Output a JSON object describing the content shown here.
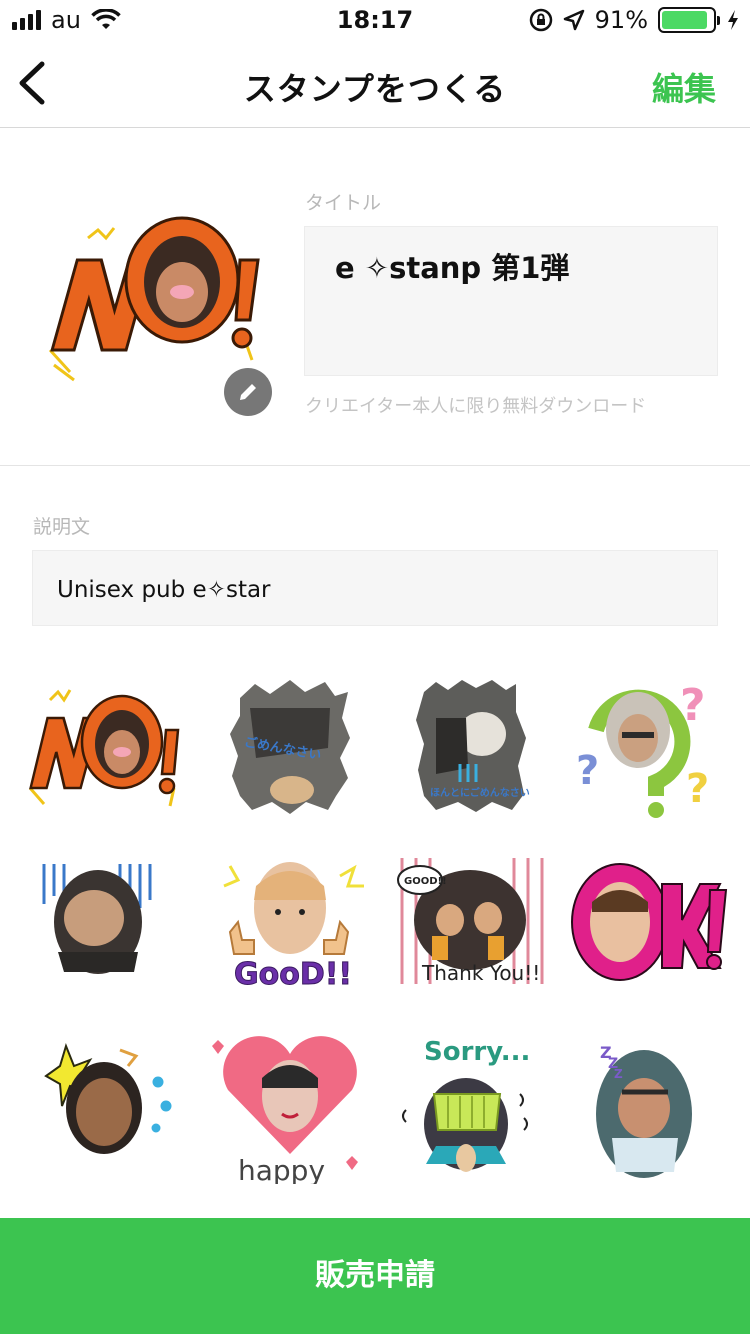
{
  "status_bar": {
    "carrier": "au",
    "time": "18:17",
    "battery": "91%",
    "battery_level": 0.91
  },
  "nav": {
    "back_icon": "chevron-left-icon",
    "title": "スタンプをつくる",
    "edit_label": "編集"
  },
  "sticker_main": {
    "text": "NO!",
    "edit_icon": "pencil-icon"
  },
  "form": {
    "title_label": "タイトル",
    "title_value": "e ✧stanp 第1弾",
    "title_hint": "クリエイター本人に限り無料ダウンロード",
    "description_label": "説明文",
    "description_value": "Unisex pub  e✧star"
  },
  "stickers": [
    {
      "name": "sticker-no",
      "text": "NO!"
    },
    {
      "name": "sticker-gomennasai",
      "text": "ごめんなさい"
    },
    {
      "name": "sticker-hontoni-gomennasai",
      "text": "ほんとにごめんなさい"
    },
    {
      "name": "sticker-question",
      "text": "?"
    },
    {
      "name": "sticker-shock",
      "text": ""
    },
    {
      "name": "sticker-good",
      "text": "GooD!!"
    },
    {
      "name": "sticker-thank-you",
      "text": "Thank You!!"
    },
    {
      "name": "sticker-ok",
      "text": "OK!"
    },
    {
      "name": "sticker-surprise",
      "text": ""
    },
    {
      "name": "sticker-happy",
      "text": "happy"
    },
    {
      "name": "sticker-sorry",
      "text": "Sorry..."
    },
    {
      "name": "sticker-sleepy",
      "text": "zzz"
    }
  ],
  "bottom": {
    "apply_label": "販売申請"
  },
  "colors": {
    "accent": "#3cc450",
    "orange": "#e8641e",
    "pink": "#e0208a"
  }
}
